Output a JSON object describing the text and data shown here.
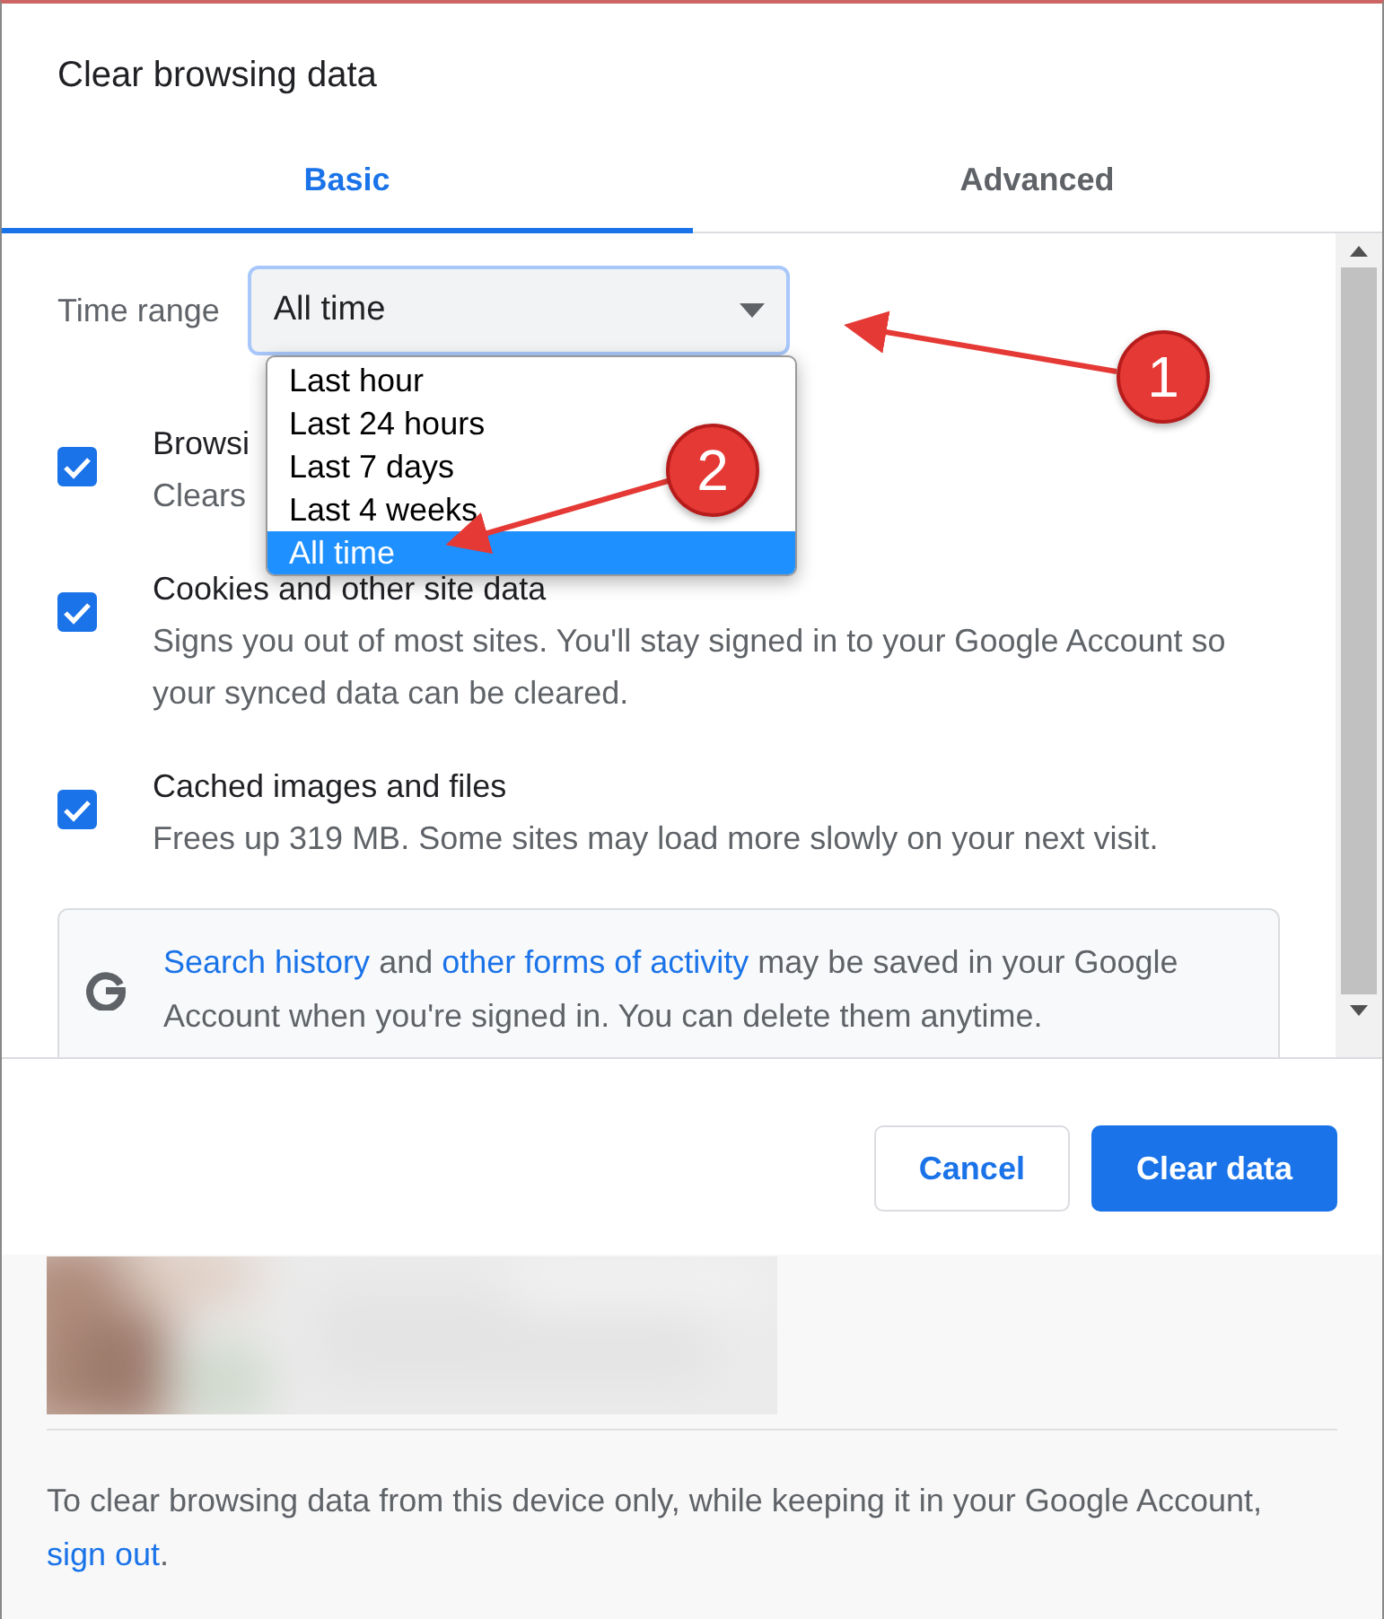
{
  "dialog": {
    "title": "Clear browsing data"
  },
  "tabs": [
    {
      "label": "Basic",
      "selected": true
    },
    {
      "label": "Advanced",
      "selected": false
    }
  ],
  "time_range": {
    "label": "Time range",
    "value": "All time",
    "expanded": true,
    "options": [
      {
        "label": "Last hour",
        "selected": false
      },
      {
        "label": "Last 24 hours",
        "selected": false
      },
      {
        "label": "Last 7 days",
        "selected": false
      },
      {
        "label": "Last 4 weeks",
        "selected": false
      },
      {
        "label": "All time",
        "selected": true
      }
    ]
  },
  "items": [
    {
      "title": "Browsi",
      "description": "Clears",
      "checked": true
    },
    {
      "title": "Cookies and other site data",
      "description": "Signs you out of most sites. You'll stay signed in to your Google Account so your synced data can be cleared.",
      "checked": true
    },
    {
      "title": "Cached images and files",
      "description": "Frees up 319 MB. Some sites may load more slowly on your next visit.",
      "checked": true
    }
  ],
  "info": {
    "segments": [
      {
        "text": "Search history",
        "link": true
      },
      {
        "text": " and ",
        "link": false
      },
      {
        "text": "other forms of activity",
        "link": true
      },
      {
        "text": " may be saved in your Google Account when you're signed in. You can delete them anytime.",
        "link": false
      }
    ]
  },
  "buttons": [
    {
      "label": "Cancel",
      "kind": "secondary"
    },
    {
      "label": "Clear data",
      "kind": "primary"
    }
  ],
  "sign_out": {
    "segments": [
      {
        "text": "To clear browsing data from this device only, while keeping it in your Google Account, ",
        "link": false
      },
      {
        "text": "sign out",
        "link": true
      },
      {
        "text": ".",
        "link": false
      }
    ]
  },
  "callouts": [
    {
      "number": "1"
    },
    {
      "number": "2"
    }
  ]
}
